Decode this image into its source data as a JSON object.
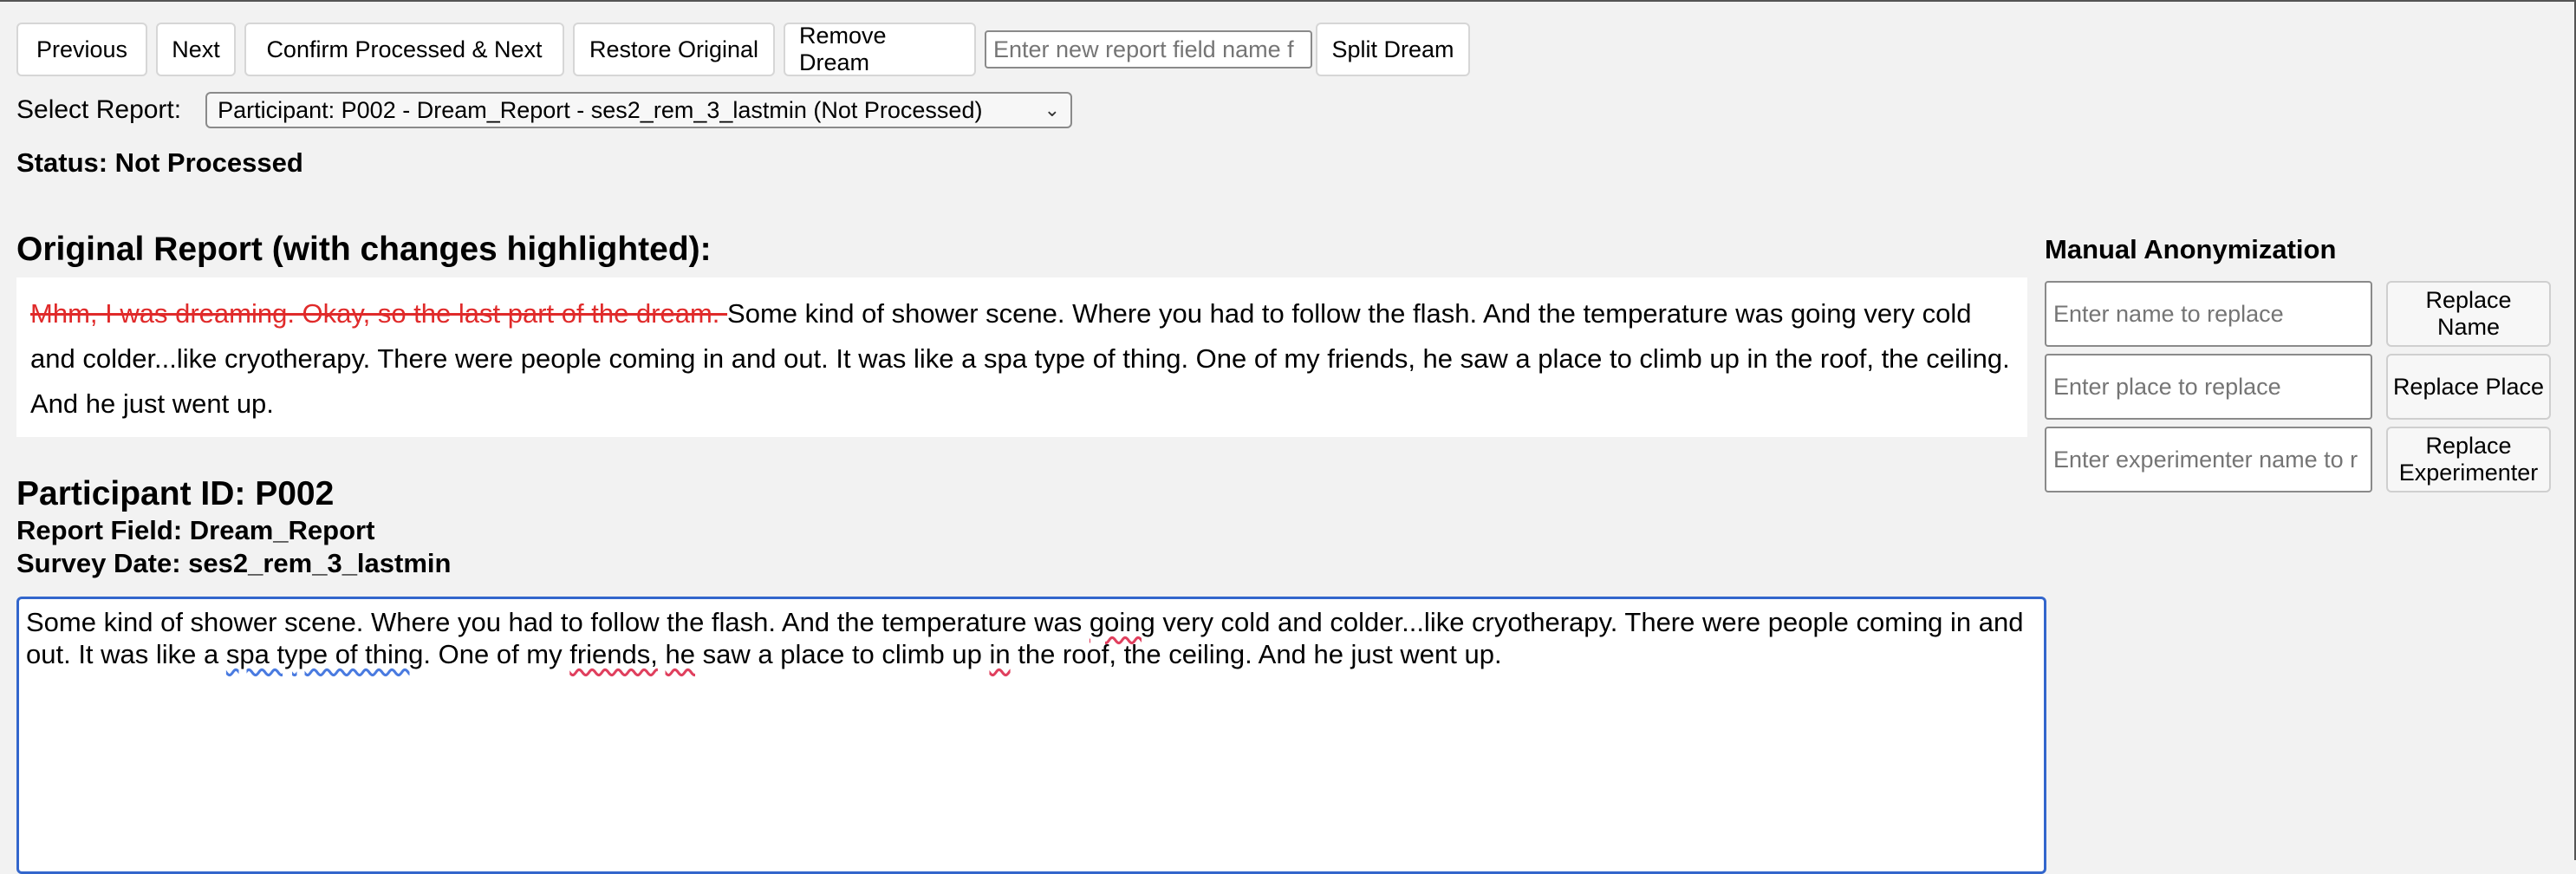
{
  "toolbar": {
    "previous": "Previous",
    "next": "Next",
    "confirm_next": "Confirm Processed & Next",
    "restore": "Restore Original",
    "remove_dream": "Remove Dream",
    "field_placeholder": "Enter new report field name f",
    "split_dream": "Split Dream"
  },
  "selector": {
    "label": "Select Report:",
    "selected": "Participant: P002 - Dream_Report - ses2_rem_3_lastmin (Not Processed)"
  },
  "status": "Status: Not Processed",
  "original": {
    "heading": "Original Report (with changes highlighted):",
    "removed_text": "Mhm, I was dreaming. Okay, so the last part of the dream. ",
    "kept_text": "Some kind of shower scene. Where you had to follow the flash. And the temperature was going very cold and colder...like cryotherapy. There were people coming in and out. It was like a spa type of thing. One of my friends, he saw a place to climb up in the roof, the ceiling. And he just went up."
  },
  "meta": {
    "participant_id": "Participant ID: P002",
    "report_field": "Report Field: Dream_Report",
    "survey_date": "Survey Date: ses2_rem_3_lastmin"
  },
  "editor": {
    "segments": [
      "Some kind of shower scene. Where you had to follow the flash. And the temperature was ",
      "going",
      " very cold and colder...like cryotherapy. There were people coming in and out. It was like a ",
      "spa type of thing",
      ". One of my ",
      "friends,",
      " ",
      "he",
      " saw a place to climb up ",
      "in",
      " the roof, the ceiling. And he just went up."
    ]
  },
  "manual": {
    "title": "Manual Anonymization",
    "name_placeholder": "Enter name to replace",
    "name_button": "Replace Name",
    "place_placeholder": "Enter place to replace",
    "place_button": "Replace Place",
    "experimenter_placeholder": "Enter experimenter name to r",
    "experimenter_button": "Replace Experimenter"
  }
}
